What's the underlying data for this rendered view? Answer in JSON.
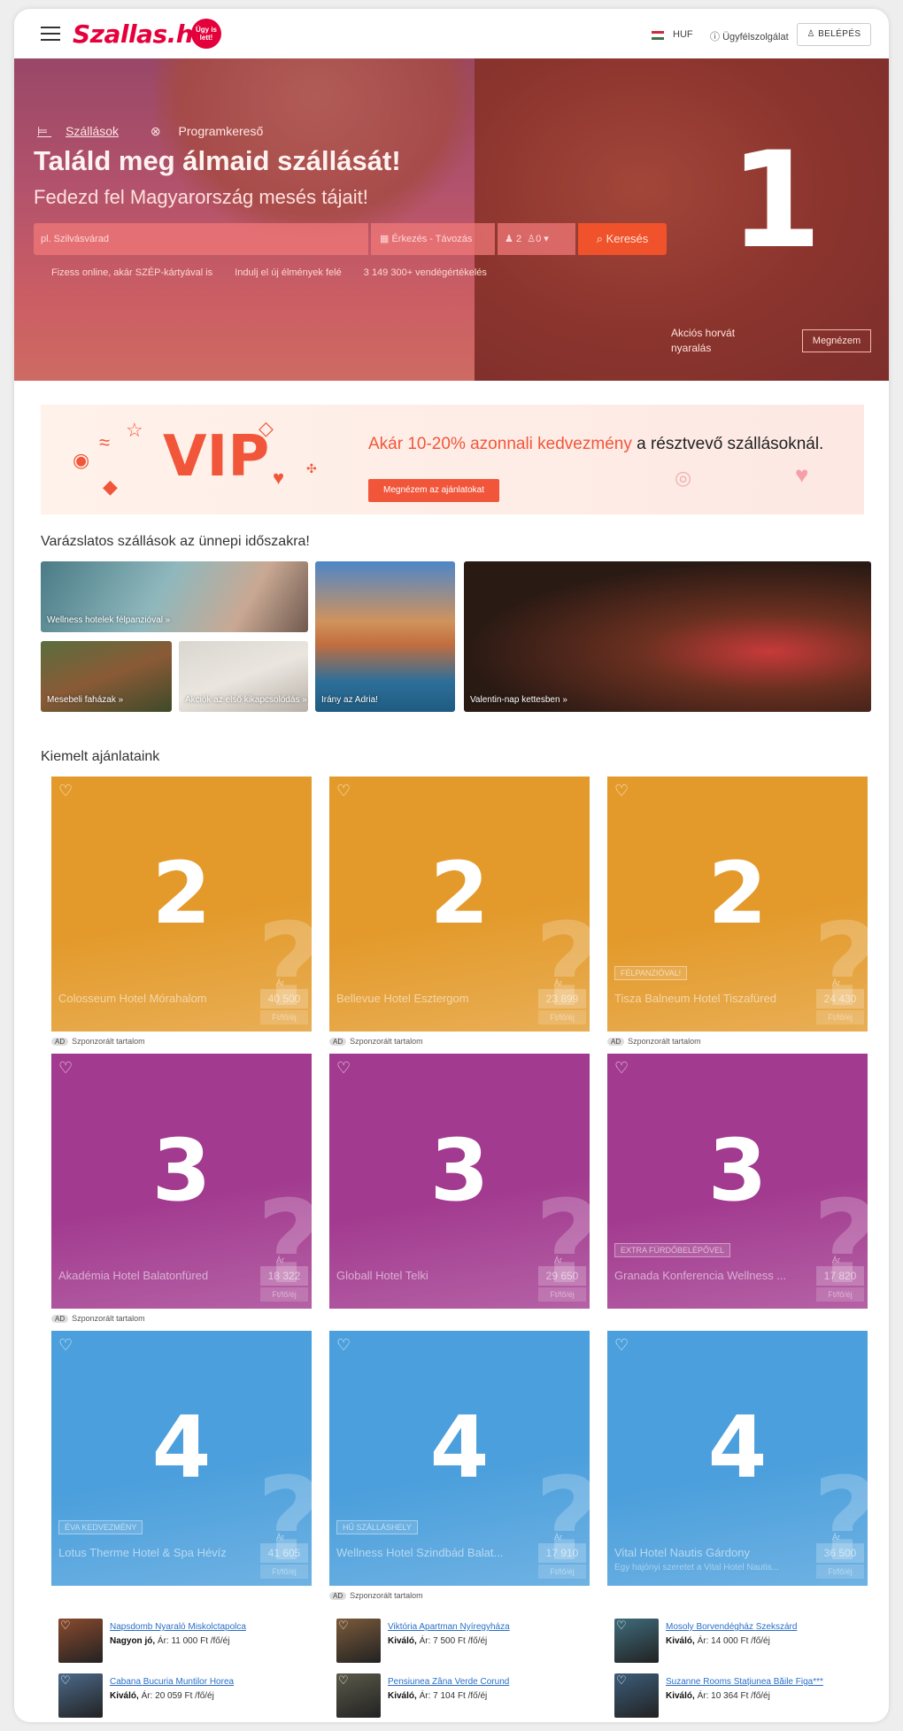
{
  "header": {
    "logo": "Szallas.hu",
    "logo_badge": "Ügy is lett!",
    "currency": "HUF",
    "support": "Ügyfélszolgálat",
    "login": "BELÉPÉS"
  },
  "hero": {
    "nav": [
      "Szállások",
      "Programkereső"
    ],
    "title": "Találd meg álmaid szállását!",
    "subtitle": "Fedezd fel Magyarország mesés tájait!",
    "search_placeholder": "pl. Szilvásvárad",
    "dates": "Érkezés - Távozás",
    "adults": "2",
    "children": "0",
    "search_button": "Keresés",
    "usps": [
      "Fizess online, akár SZÉP-kártyával is",
      "Indulj el új élmények felé",
      "3 149 300+ vendégértékelés"
    ],
    "promo_text_line1": "Akciós horvát",
    "promo_text_line2": "nyaralás",
    "promo_button": "Megnézem",
    "annotation": "1"
  },
  "vip": {
    "logo": "VIP",
    "headline_accent": "Akár 10-20% azonnali kedvezmény",
    "headline_rest": " a résztvevő szállásoknál.",
    "button": "Megnézem az ajánlatokat"
  },
  "collage": {
    "title": "Varázslatos szállások az ünnepi időszakra!",
    "tiles": [
      "Wellness hotelek félpanzióval »",
      "Mesebeli faházak »",
      "Akciók az első kikapcsolódás »",
      "Irány az Adria!",
      "Valentin-nap kettesben »"
    ]
  },
  "featured": {
    "title": "Kiemelt ajánlataink",
    "sponsored": "Szponzorált tartalom",
    "ad": "AD",
    "price_label": "Ár",
    "price_unit": "Ft/fő/éj",
    "rows": [
      {
        "annotation": "2",
        "color": "#e39a2b",
        "cards": [
          {
            "name": "Colosseum Hotel Mórahalom",
            "price": "40 500",
            "badge": "",
            "desc": ""
          },
          {
            "name": "Bellevue Hotel Esztergom",
            "price": "23 899",
            "badge": "",
            "desc": ""
          },
          {
            "name": "Tisza Balneum Hotel Tiszafüred",
            "price": "24 430",
            "badge": "FÉLPANZIÓVAL!",
            "desc": ""
          }
        ]
      },
      {
        "annotation": "3",
        "color": "#a23a8f",
        "cards": [
          {
            "name": "Akadémia Hotel Balatonfüred",
            "price": "18 322",
            "badge": "",
            "desc": ""
          },
          {
            "name": "Globall Hotel Telki",
            "price": "29 650",
            "badge": "",
            "desc": ""
          },
          {
            "name": "Granada Konferencia Wellness ...",
            "price": "17 820",
            "badge": "EXTRA FÜRDŐBELÉPŐVEL",
            "desc": ""
          }
        ]
      },
      {
        "annotation": "4",
        "color": "#4b9fdc",
        "cards": [
          {
            "name": "Lotus Therme Hotel & Spa Hévíz",
            "price": "41 605",
            "badge": "ÉVA KEDVEZMÉNY",
            "desc": ""
          },
          {
            "name": "Wellness Hotel Szindbád Balat...",
            "price": "17 910",
            "badge": "HŰ SZÁLLÁSHELY",
            "desc": ""
          },
          {
            "name": "Vital Hotel Nautis Gárdony",
            "price": "36 500",
            "badge": "",
            "desc": "Egy hajónyi szeretet a Vital Hotel Nautis..."
          }
        ]
      }
    ]
  },
  "mini_listings": [
    {
      "name": "Napsdomb Nyaraló Miskolctapolca",
      "rating": "Nagyon jó,",
      "price": "Ár: 11 000 Ft /fő/éj"
    },
    {
      "name": "Viktória Apartman Nyíregyháza",
      "rating": "Kiváló,",
      "price": "Ár: 7 500 Ft /fő/éj"
    },
    {
      "name": "Mosoly Borvendégház Szekszárd",
      "rating": "Kiváló,",
      "price": "Ár: 14 000 Ft /fő/éj"
    },
    {
      "name": "Cabana Bucuria Muntilor Horea",
      "rating": "Kiváló,",
      "price": "Ár: 20 059 Ft /fő/éj"
    },
    {
      "name": "Pensiunea Zâna Verde Corund",
      "rating": "Kiváló,",
      "price": "Ár: 7 104 Ft /fő/éj"
    },
    {
      "name": "Suzanne Rooms Stațiunea Băile Figa***",
      "rating": "Kiváló,",
      "price": "Ár: 10 364 Ft /fő/éj"
    }
  ]
}
